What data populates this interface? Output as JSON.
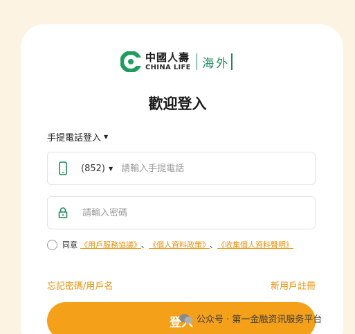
{
  "brand": {
    "name_cn": "中國人壽",
    "name_en": "CHINA LIFE",
    "region": "海外"
  },
  "title": "歡迎登入",
  "login_method": {
    "label": "手提電話登入"
  },
  "phone": {
    "country_code": "(852)",
    "placeholder": "請輸入手提電話"
  },
  "password": {
    "placeholder": "請輸入密碼"
  },
  "agreement": {
    "prefix": "同意",
    "links": [
      "《用戶服務協議》",
      "《個人資料政策》",
      "《收集個人資料聲明》"
    ],
    "separator": "、"
  },
  "links": {
    "forgot": "忘記密碼/用戶名",
    "register": "新用戶註冊"
  },
  "login_button": "登入",
  "watermark": "公众号 · 第一金融资讯服务平台",
  "colors": {
    "accent": "#f4a019",
    "link": "#e8920b",
    "brand_green": "#1f8a57"
  },
  "icons": {
    "logo": "china-life-logo-icon",
    "phone": "mobile-phone-icon",
    "password": "lock-icon",
    "caret": "caret-down-icon"
  }
}
